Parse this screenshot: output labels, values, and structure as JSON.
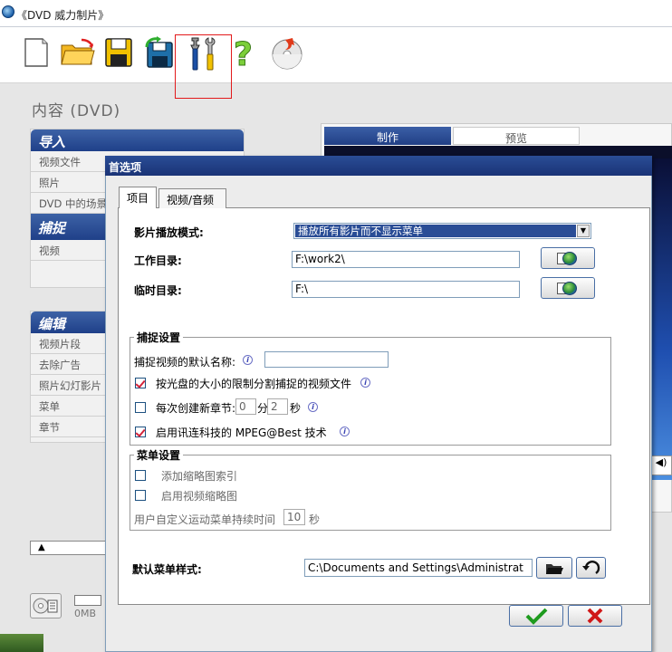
{
  "window": {
    "title": "《DVD 威力制片》"
  },
  "toolbar": {
    "buttons": [
      "new-icon",
      "open-icon",
      "save-icon",
      "save-as-icon",
      "tools-icon",
      "help-icon",
      "burn-icon"
    ]
  },
  "content_title": "内容 (DVD)",
  "left_panels": {
    "import": {
      "header": "导入",
      "items": [
        "视频文件",
        "照片",
        "DVD 中的场景"
      ]
    },
    "capture": {
      "header": "捕捉",
      "items": [
        "视频"
      ]
    },
    "edit": {
      "header": "编辑",
      "items": [
        "视频片段",
        "去除广告",
        "照片幻灯影片",
        "菜单",
        "章节"
      ]
    }
  },
  "right_tabs": {
    "make": "制作",
    "preview": "预览"
  },
  "bottom": {
    "size": "0MB"
  },
  "dialog": {
    "title": "首选项",
    "tabs": [
      "项目",
      "视频/音频"
    ],
    "playback_mode": {
      "label": "影片播放模式:",
      "value": "播放所有影片而不显示菜单"
    },
    "work_dir": {
      "label": "工作目录:",
      "value": "F:\\work2\\"
    },
    "temp_dir": {
      "label": "临时目录:",
      "value": "F:\\"
    },
    "capture_settings": {
      "title": "捕捉设置",
      "default_name_label": "捕捉视频的默认名称:",
      "default_name_value": "",
      "split_by_disc": {
        "label": "按光盘的大小的限制分割捕捉的视频文件",
        "checked": true
      },
      "chapter_every": {
        "label": "每次创建新章节:",
        "minutes": "0",
        "min_unit": "分",
        "seconds": "2",
        "sec_unit": "秒",
        "checked": false
      },
      "mpeg_best": {
        "label": "启用讯连科技的 MPEG@Best 技术",
        "checked": true
      }
    },
    "menu_settings": {
      "title": "菜单设置",
      "add_thumb_index": {
        "label": "添加缩略图索引",
        "checked": false
      },
      "enable_thumb": {
        "label": "启用视频缩略图",
        "checked": false
      },
      "duration_label": "用户自定义运动菜单持续时间",
      "duration_value": "10",
      "duration_unit": "秒"
    },
    "default_menu_style": {
      "label": "默认菜单样式:",
      "value": "C:\\Documents and Settings\\Administrat"
    },
    "colors": {
      "title_bar": "#1a3376",
      "check_mark": "#d4233a",
      "ok": "#1e9b1e",
      "cancel": "#d01818"
    }
  }
}
